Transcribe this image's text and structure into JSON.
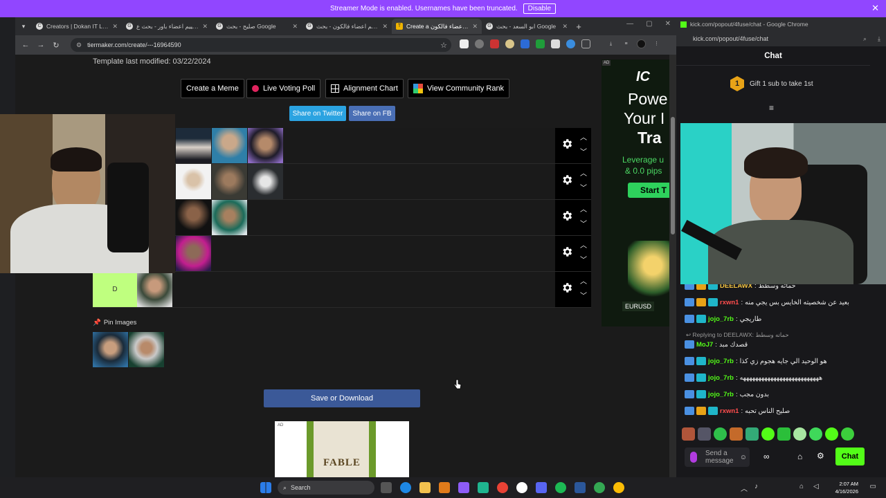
{
  "banner": {
    "text": "Streamer Mode is enabled. Usernames have been truncated.",
    "disable_label": "Disable",
    "close_glyph": "✕"
  },
  "browser": {
    "tabs": [
      {
        "label": "Creators | Dokan IT LLC",
        "icon": "C",
        "active": false
      },
      {
        "label": "تقييم اعضاء باور - بحث ع...",
        "icon": "G",
        "active": false
      },
      {
        "label": "صليح - بحث Google",
        "icon": "G",
        "active": false
      },
      {
        "label": "تقييم اعضاء فالكون - بحث...",
        "icon": "G",
        "active": false
      },
      {
        "label": "Create a تقييم اعضاء فالكون",
        "icon": "T",
        "active": true
      },
      {
        "label": "ابو السعد - بحث Google",
        "icon": "G",
        "active": false
      }
    ],
    "url": "tiermaker.com/create/---16964590"
  },
  "page": {
    "template_modified": "Template last modified: 03/22/2024",
    "buttons": {
      "create_meme": "Create a Meme",
      "live_voting": "Live Voting Poll",
      "alignment_chart": "Alignment Chart",
      "community_rank": "View Community Rank"
    },
    "share": {
      "twitter": "Share on Twitter",
      "fb": "Share on FB"
    },
    "tiers": [
      {
        "label": "",
        "color": "#ff7f7f",
        "items": 3
      },
      {
        "label": "",
        "color": "#ffbf7f",
        "items": 3
      },
      {
        "label": "",
        "color": "#ffdf7f",
        "items": 2
      },
      {
        "label": "",
        "color": "#ffff7f",
        "items": 1
      },
      {
        "label": "D",
        "color": "#bfff7f",
        "items": 1
      }
    ],
    "pin_images_label": "Pin Images",
    "save_download": "Save or Download",
    "ad_label": "AD",
    "side_ad": {
      "badge": "AD",
      "brand": "IC",
      "headline1": "Powe",
      "headline2": "Your I",
      "headline3": "Tra",
      "sub1": "Leverage u",
      "sub2": "& 0.0 pips",
      "cta": "Start T",
      "pair": "EURUSD"
    },
    "bottom_ad_title": "FABLE"
  },
  "chat": {
    "window_title": "kick.com/popout/4fuse/chat - Google Chrome",
    "url": "kick.com/popout/4fuse/chat",
    "header": "Chat",
    "gift_number": "1",
    "gift_text": "Gift 1 sub to take 1st",
    "messages": [
      {
        "user": "DEELAWX",
        "text": "حماته وسطط",
        "color": "#f5c542"
      },
      {
        "user": "rxwn1",
        "text": "بعيد عن شخصيته الخايس بس يجي منه",
        "color": "#ff4d4d"
      },
      {
        "user": "jojo_7rb",
        "text": "طاريجي",
        "color": "#53fc18"
      },
      {
        "user": "MoJ7",
        "text": "قصدك مبد",
        "color": "#53fc18"
      },
      {
        "user": "jojo_7rb",
        "text": "هو الوحيد الي جايه هجوم زي كذا",
        "color": "#53fc18"
      },
      {
        "user": "jojo_7rb",
        "text": "ههههههههههههههههههههههههههه",
        "color": "#53fc18"
      },
      {
        "user": "jojo_7rb",
        "text": "بدون مجب",
        "color": "#53fc18"
      },
      {
        "user": "rxwn1",
        "text": "صليح الناس تحبه",
        "color": "#ff4d4d"
      }
    ],
    "reply_text": "Replying to DEELAWX: حماته وسطط",
    "input_placeholder": "Send a message",
    "chat_button": "Chat"
  },
  "taskbar": {
    "search_label": "Search",
    "time": "2:07 AM",
    "date": "4/16/2026"
  },
  "colors": {
    "accent_purple": "#9146ff",
    "kick_green": "#53fc18",
    "twitter_blue": "#2ba3e1",
    "fb_blue": "#3b5998"
  }
}
